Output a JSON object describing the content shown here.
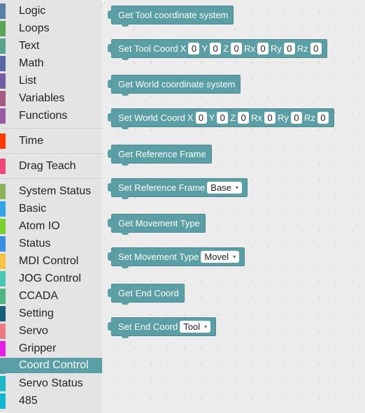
{
  "sidebar": {
    "items": [
      {
        "label": "Logic",
        "color": "#5b80a5"
      },
      {
        "label": "Loops",
        "color": "#5ba55b"
      },
      {
        "label": "Text",
        "color": "#5ba58c"
      },
      {
        "label": "Math",
        "color": "#5b67a5"
      },
      {
        "label": "List",
        "color": "#745ba5"
      },
      {
        "label": "Variables",
        "color": "#a55b80"
      },
      {
        "label": "Functions",
        "color": "#995ba5"
      },
      {
        "label": "Time",
        "color": "#ff3d00"
      },
      {
        "label": "Drag Teach",
        "color": "#f0467a"
      },
      {
        "label": "System Status",
        "color": "#8ab35a"
      },
      {
        "label": "Basic",
        "color": "#33a4e6"
      },
      {
        "label": "Atom IO",
        "color": "#78d12c"
      },
      {
        "label": "Status",
        "color": "#3a8fe0"
      },
      {
        "label": "MDI Control",
        "color": "#f5c242"
      },
      {
        "label": "JOG Control",
        "color": "#4ac7b3"
      },
      {
        "label": "CCADA",
        "color": "#4fb582"
      },
      {
        "label": "Setting",
        "color": "#1a5d7a"
      },
      {
        "label": "Servo",
        "color": "#ee7a84"
      },
      {
        "label": "Gripper",
        "color": "#e61ee6"
      },
      {
        "label": "Coord Control",
        "color": "#5a9fa6",
        "selected": true
      },
      {
        "label": "Servo Status",
        "color": "#1cb8c8"
      },
      {
        "label": "485",
        "color": "#10b8d4"
      }
    ]
  },
  "blocks": {
    "get_tool_coord": "Get Tool coordinate system",
    "set_tool_coord": {
      "label": "Set Tool Coord",
      "x_label": "X",
      "x": "0",
      "y_label": "Y",
      "y": "0",
      "z_label": "Z",
      "z": "0",
      "rx_label": "Rx",
      "rx": "0",
      "ry_label": "Ry",
      "ry": "0",
      "rz_label": "Rz",
      "rz": "0"
    },
    "get_world_coord": "Get World coordinate system",
    "set_world_coord": {
      "label": "Set World Coord",
      "x_label": "X",
      "x": "0",
      "y_label": "Y",
      "y": "0",
      "z_label": "Z",
      "z": "0",
      "rx_label": "Rx",
      "rx": "0",
      "ry_label": "Ry",
      "ry": "0",
      "rz_label": "Rz",
      "rz": "0"
    },
    "get_reference_frame": "Get Reference Frame",
    "set_reference_frame": {
      "label": "Set Reference Frame",
      "value": "Base"
    },
    "get_movement_type": "Get Movement Type",
    "set_movement_type": {
      "label": "Set Movement Type",
      "value": "Movel"
    },
    "get_end_coord": "Get End Coord",
    "set_end_coord": {
      "label": "Set End Coord",
      "value": "Tool"
    },
    "dropdown_arrow": "▾"
  }
}
